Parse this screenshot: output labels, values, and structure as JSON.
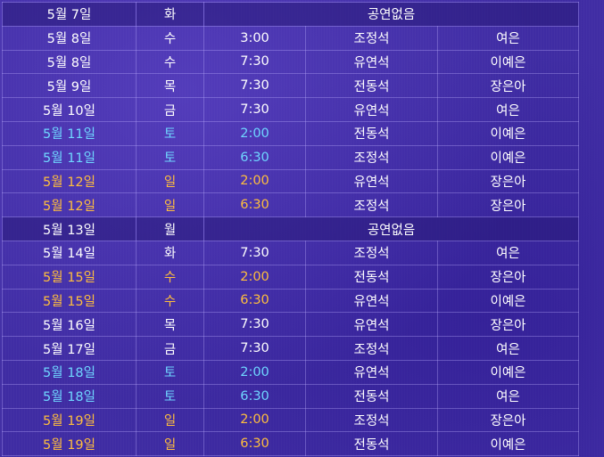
{
  "rows": [
    {
      "date": "5월 7일",
      "day": "화",
      "no_show": true,
      "note": "공연없음"
    },
    {
      "date": "5월 8일",
      "day": "수",
      "time": "3:00",
      "actor1": "조정석",
      "actor2": "여은"
    },
    {
      "date": "5월 8일",
      "day": "수",
      "time": "7:30",
      "actor1": "유연석",
      "actor2": "이예은"
    },
    {
      "date": "5월 9일",
      "day": "목",
      "time": "7:30",
      "actor1": "전동석",
      "actor2": "장은아"
    },
    {
      "date": "5월 10일",
      "day": "금",
      "time": "7:30",
      "actor1": "유연석",
      "actor2": "여은"
    },
    {
      "date": "5월 11일",
      "day": "토",
      "time": "2:00",
      "actor1": "전동석",
      "actor2": "이예은",
      "tone": "sat"
    },
    {
      "date": "5월 11일",
      "day": "토",
      "time": "6:30",
      "actor1": "조정석",
      "actor2": "이예은",
      "tone": "sat"
    },
    {
      "date": "5월 12일",
      "day": "일",
      "time": "2:00",
      "actor1": "유연석",
      "actor2": "장은아",
      "tone": "sun"
    },
    {
      "date": "5월 12일",
      "day": "일",
      "time": "6:30",
      "actor1": "조정석",
      "actor2": "장은아",
      "tone": "sun"
    },
    {
      "date": "5월 13일",
      "day": "월",
      "no_show": true,
      "note": "공연없음"
    },
    {
      "date": "5월 14일",
      "day": "화",
      "time": "7:30",
      "actor1": "조정석",
      "actor2": "여은"
    },
    {
      "date": "5월 15일",
      "day": "수",
      "time": "2:00",
      "actor1": "전동석",
      "actor2": "장은아",
      "tone": "sun"
    },
    {
      "date": "5월 15일",
      "day": "수",
      "time": "6:30",
      "actor1": "유연석",
      "actor2": "이예은",
      "tone": "sun"
    },
    {
      "date": "5월 16일",
      "day": "목",
      "time": "7:30",
      "actor1": "유연석",
      "actor2": "장은아"
    },
    {
      "date": "5월 17일",
      "day": "금",
      "time": "7:30",
      "actor1": "조정석",
      "actor2": "여은"
    },
    {
      "date": "5월 18일",
      "day": "토",
      "time": "2:00",
      "actor1": "유연석",
      "actor2": "이예은",
      "tone": "sat"
    },
    {
      "date": "5월 18일",
      "day": "토",
      "time": "6:30",
      "actor1": "전동석",
      "actor2": "여은",
      "tone": "sat"
    },
    {
      "date": "5월 19일",
      "day": "일",
      "time": "2:00",
      "actor1": "조정석",
      "actor2": "장은아",
      "tone": "sun"
    },
    {
      "date": "5월 19일",
      "day": "일",
      "time": "6:30",
      "actor1": "전동석",
      "actor2": "이예은",
      "tone": "sun"
    }
  ],
  "colors": {
    "background": "#3f2ca3",
    "text": "#ffffff",
    "saturday": "#6fd6ff",
    "sunday_holiday": "#ffbe3d",
    "grid": "#bfb0ff"
  }
}
